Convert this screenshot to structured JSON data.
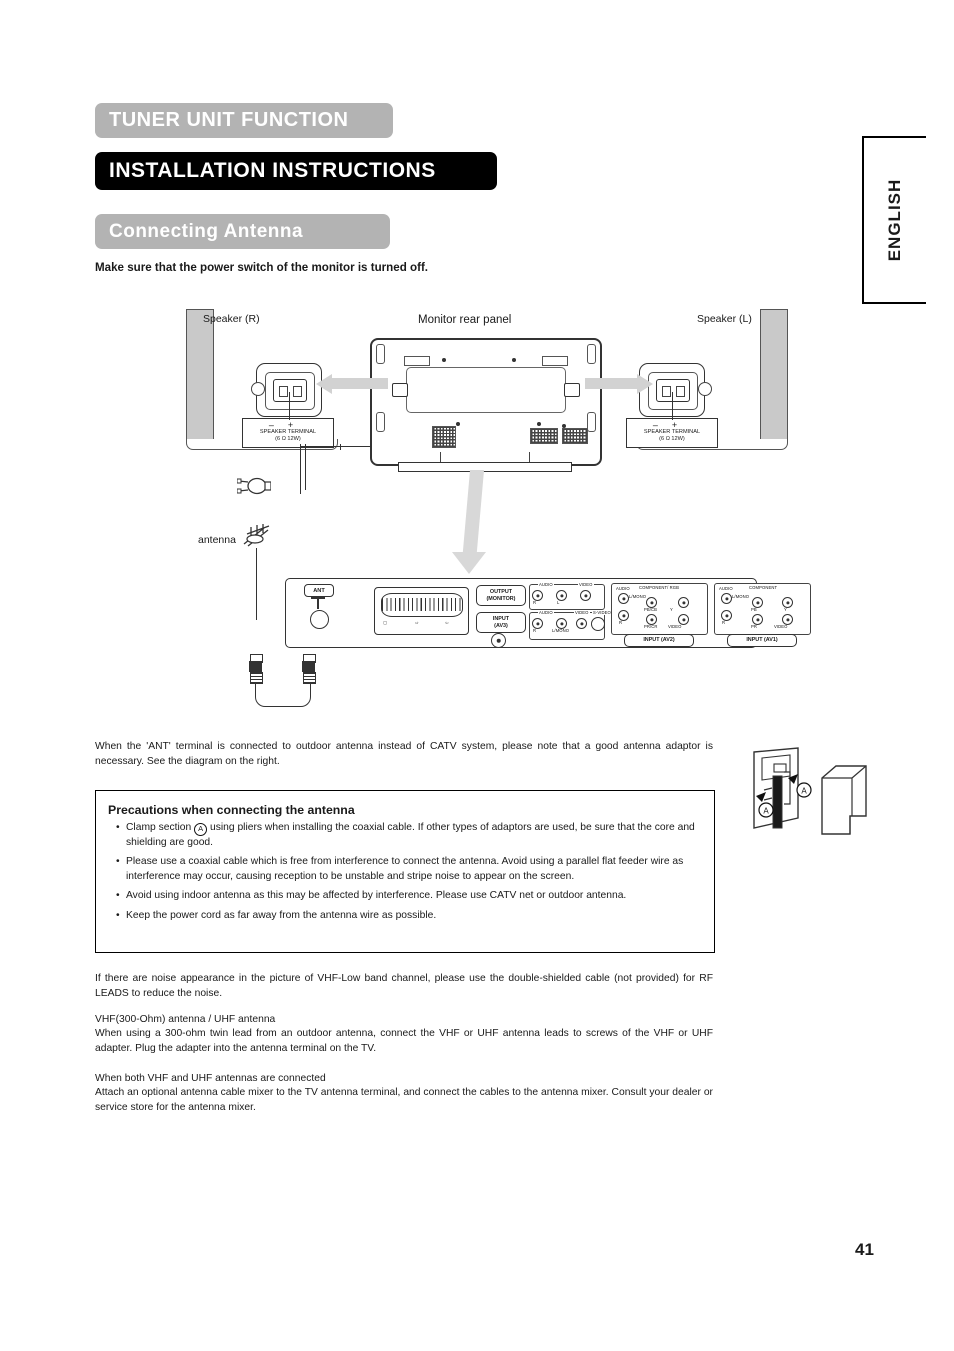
{
  "banners": {
    "tuner": "TUNER UNIT FUNCTION",
    "install": "INSTALLATION INSTRUCTIONS",
    "connect": "Connecting Antenna"
  },
  "colors": {
    "banner_gray": "#b3b3b3",
    "banner_black": "#000000",
    "arrow_gray": "#d2d2d2",
    "speaker_fill": "#c9c9c9"
  },
  "notice": "Make sure that the power switch of the monitor is turned off.",
  "side_tab": {
    "language": "ENGLISH"
  },
  "diagram": {
    "speaker_right_label": "Speaker (R)",
    "speaker_left_label": "Speaker (L)",
    "monitor_label": "Monitor rear panel",
    "antenna_label": "antenna",
    "speaker_terminal": {
      "minus": "–",
      "plus": "+",
      "line1": "SPEAKER TERMINAL",
      "line2": "(6 Ω 12W)"
    },
    "connector_panel": {
      "ant": "ANT",
      "output_monitor_line1": "OUTPUT",
      "output_monitor_line2": "(MONITOR)",
      "input_av3_line1": "INPUT",
      "input_av3_line2": "(AV3)",
      "input_av2": "INPUT (AV2)",
      "input_av1": "INPUT (AV1)",
      "audio": "AUDIO",
      "video": "VIDEO",
      "s_video": "S-VIDEO",
      "component_rgb": "COMPONENT/ RGB",
      "component": "COMPONENT",
      "l_mono": "L/MONO",
      "ch_r": "R",
      "ch_l": "L",
      "pb_cb": "PB/CB",
      "pr_cr": "PR/CR",
      "y": "Y",
      "pb": "PB",
      "pr": "PR"
    }
  },
  "intro_paragraph": "When the 'ANT' terminal is connected to outdoor antenna instead of CATV system, please note that a good antenna adaptor is necessary. See the diagram on the right.",
  "precautions": {
    "title": "Precautions when connecting the antenna",
    "marker": "A",
    "bullet1_pre": "Clamp section ",
    "bullet1_post": " using pliers when installing the coaxial cable. If other types of adaptors are used, be sure that the core and shielding are good.",
    "bullet2": "Please use a coaxial cable which is free from interference to connect the antenna. Avoid using a parallel flat feeder wire as interference may occur, causing reception to be unstable and stripe noise to appear on the screen.",
    "bullet3": "Avoid using indoor antenna as this may be affected by interference. Please use CATV net or outdoor antenna.",
    "bullet4": "Keep the power cord as far away from the antenna wire as possible."
  },
  "notes": {
    "noise": "If there are noise appearance in the picture of VHF-Low band channel, please use the double-shielded cable (not provided) for RF LEADS to reduce the noise.",
    "vhf_heading": "VHF(300-Ohm) antenna / UHF antenna",
    "vhf_body": "When using a 300-ohm twin lead from an outdoor antenna, connect the VHF or UHF antenna leads to screws of the VHF or UHF adapter. Plug the adapter into the antenna terminal on the TV.",
    "both_heading": "When both VHF and UHF antennas are connected",
    "both_body": "Attach an optional antenna cable mixer to the TV antenna terminal, and connect the cables to the antenna mixer. Consult your dealer or service store for the antenna mixer."
  },
  "page_number": "41"
}
